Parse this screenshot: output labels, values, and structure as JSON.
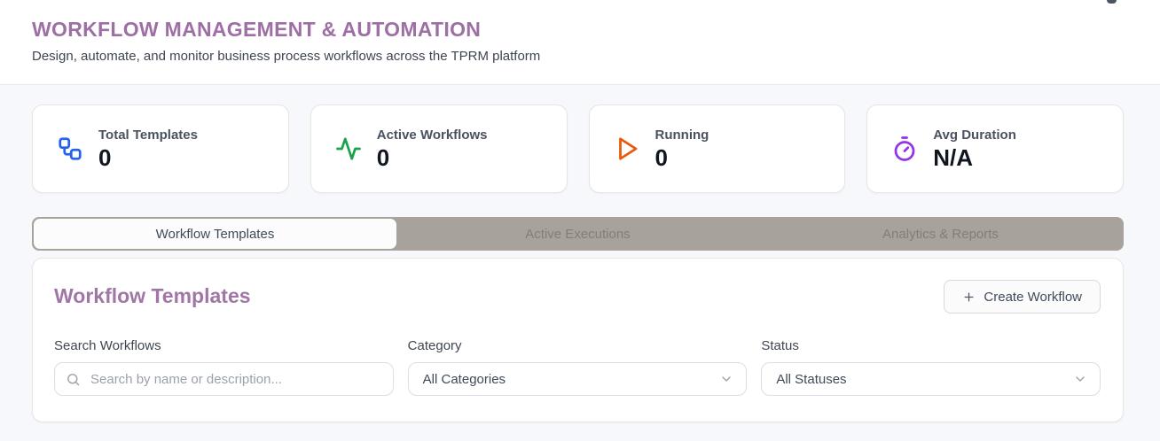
{
  "header": {
    "title": "WORKFLOW MANAGEMENT & AUTOMATION",
    "subtitle": "Design, automate, and monitor business process workflows across the TPRM platform"
  },
  "stats": [
    {
      "label": "Total Templates",
      "value": "0",
      "icon": "workflow-icon",
      "color": "#2563eb"
    },
    {
      "label": "Active Workflows",
      "value": "0",
      "icon": "activity-icon",
      "color": "#16a34a"
    },
    {
      "label": "Running",
      "value": "0",
      "icon": "play-icon",
      "color": "#ea580c"
    },
    {
      "label": "Avg Duration",
      "value": "N/A",
      "icon": "timer-icon",
      "color": "#9333ea"
    }
  ],
  "tabs": [
    {
      "label": "Workflow Templates",
      "active": true
    },
    {
      "label": "Active Executions",
      "active": false
    },
    {
      "label": "Analytics & Reports",
      "active": false
    }
  ],
  "panel": {
    "title": "Workflow Templates",
    "create_button": {
      "label": "Create Workflow",
      "icon": "plus-icon"
    },
    "filters": {
      "search": {
        "label": "Search Workflows",
        "placeholder": "Search by name or description...",
        "value": "",
        "icon": "search-icon"
      },
      "category": {
        "label": "Category",
        "selected": "All Categories",
        "icon": "chevron-down-icon"
      },
      "status": {
        "label": "Status",
        "selected": "All Statuses",
        "icon": "chevron-down-icon"
      }
    }
  },
  "colors": {
    "page_title": "#9e6fa4",
    "section_title": "#a176a6",
    "tab_bar_bg": "#a8a29c",
    "stat_blue": "#2563eb",
    "stat_green": "#16a34a",
    "stat_orange": "#ea580c",
    "stat_purple": "#9333ea"
  }
}
